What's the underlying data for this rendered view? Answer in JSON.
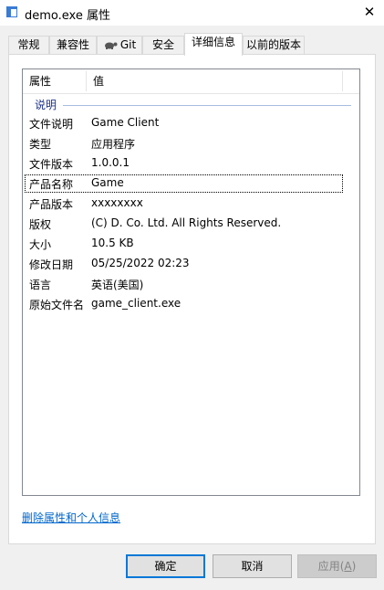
{
  "window": {
    "title": "demo.exe 属性",
    "close": "✕"
  },
  "tabs": [
    {
      "label": "常规"
    },
    {
      "label": "兼容性"
    },
    {
      "label": "Git"
    },
    {
      "label": "安全"
    },
    {
      "label": "详细信息",
      "active": true
    },
    {
      "label": "以前的版本"
    }
  ],
  "table": {
    "headers": [
      "属性",
      "值"
    ],
    "group": "说明",
    "rows": [
      {
        "key": "文件说明",
        "value": "Game Client"
      },
      {
        "key": "类型",
        "value": "应用程序"
      },
      {
        "key": "文件版本",
        "value": "1.0.0.1"
      },
      {
        "key": "产品名称",
        "value": "Game"
      },
      {
        "key": "产品版本",
        "value": "xxxxxxxx"
      },
      {
        "key": "版权",
        "value": "(C) D. Co. Ltd. All Rights Reserved."
      },
      {
        "key": "大小",
        "value": "10.5 KB"
      },
      {
        "key": "修改日期",
        "value": "05/25/2022 02:23"
      },
      {
        "key": "语言",
        "value": "英语(美国)"
      },
      {
        "key": "原始文件名",
        "value": "game_client.exe"
      }
    ]
  },
  "link": "删除属性和个人信息",
  "buttons": {
    "ok": "确定",
    "cancel": "取消",
    "apply_prefix": "应用(",
    "apply_key": "A",
    "apply_suffix": ")"
  },
  "colors": {
    "accent": "#0078d7",
    "link": "#0066cc",
    "group": "#1e3287"
  }
}
